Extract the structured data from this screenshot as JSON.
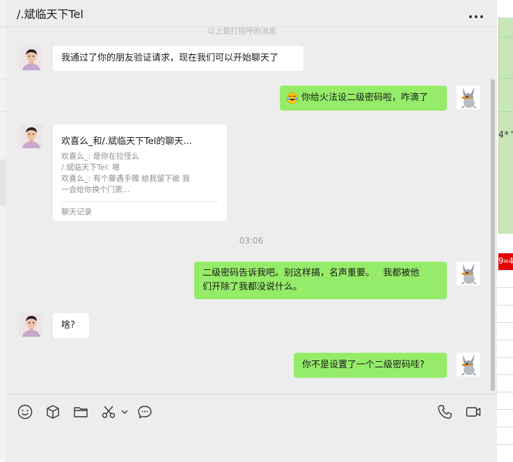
{
  "chat": {
    "title": "/.斌临天下Tel",
    "clipped_system_text": "以上是打招呼的消息",
    "messages": [
      {
        "side": "left",
        "kind": "text",
        "text": "我通过了你的朋友验证请求，现在我们可以开始聊天了"
      },
      {
        "side": "right",
        "kind": "text",
        "emoji": "laughing-tears-emoji",
        "text": "你给火法设二级密码啦，咋滴了"
      },
      {
        "side": "left",
        "kind": "chat-record",
        "title": "欢喜么_和/.斌临天下Tel的聊天...",
        "lines": [
          "欢喜么_: 是你在拉怪么",
          "/.斌临天下Tel: 嗯",
          "欢喜么_: 有个藤遇手镯 给我留下被 我",
          "一会给你换个门票..."
        ],
        "footer": "聊天记录"
      },
      {
        "side": "center",
        "kind": "time",
        "text": "03:06"
      },
      {
        "side": "right",
        "kind": "text",
        "line1": "二级密码告诉我吧。别这样搞，名声重要。   我都被他",
        "line2": "们开除了我都没说什么。"
      },
      {
        "side": "left",
        "kind": "text",
        "text": "啥?"
      },
      {
        "side": "right",
        "kind": "text",
        "text": "你不是设置了一个二级密码哇?"
      }
    ]
  },
  "background_window": {
    "cell_text": "4*'",
    "red_cell_text": "9=4"
  },
  "colors": {
    "self_bubble": "#95ec69",
    "other_bubble": "#ffffff",
    "chat_background": "#ededed",
    "red_cell": "#e60000"
  },
  "toolbar": {
    "left_icons": [
      "emoji-icon",
      "sticker-box-icon",
      "folder-icon",
      "scissors-icon",
      "chevron-down-icon",
      "chat-bubble-icon"
    ],
    "right_icons": [
      "phone-icon",
      "video-call-icon"
    ]
  }
}
